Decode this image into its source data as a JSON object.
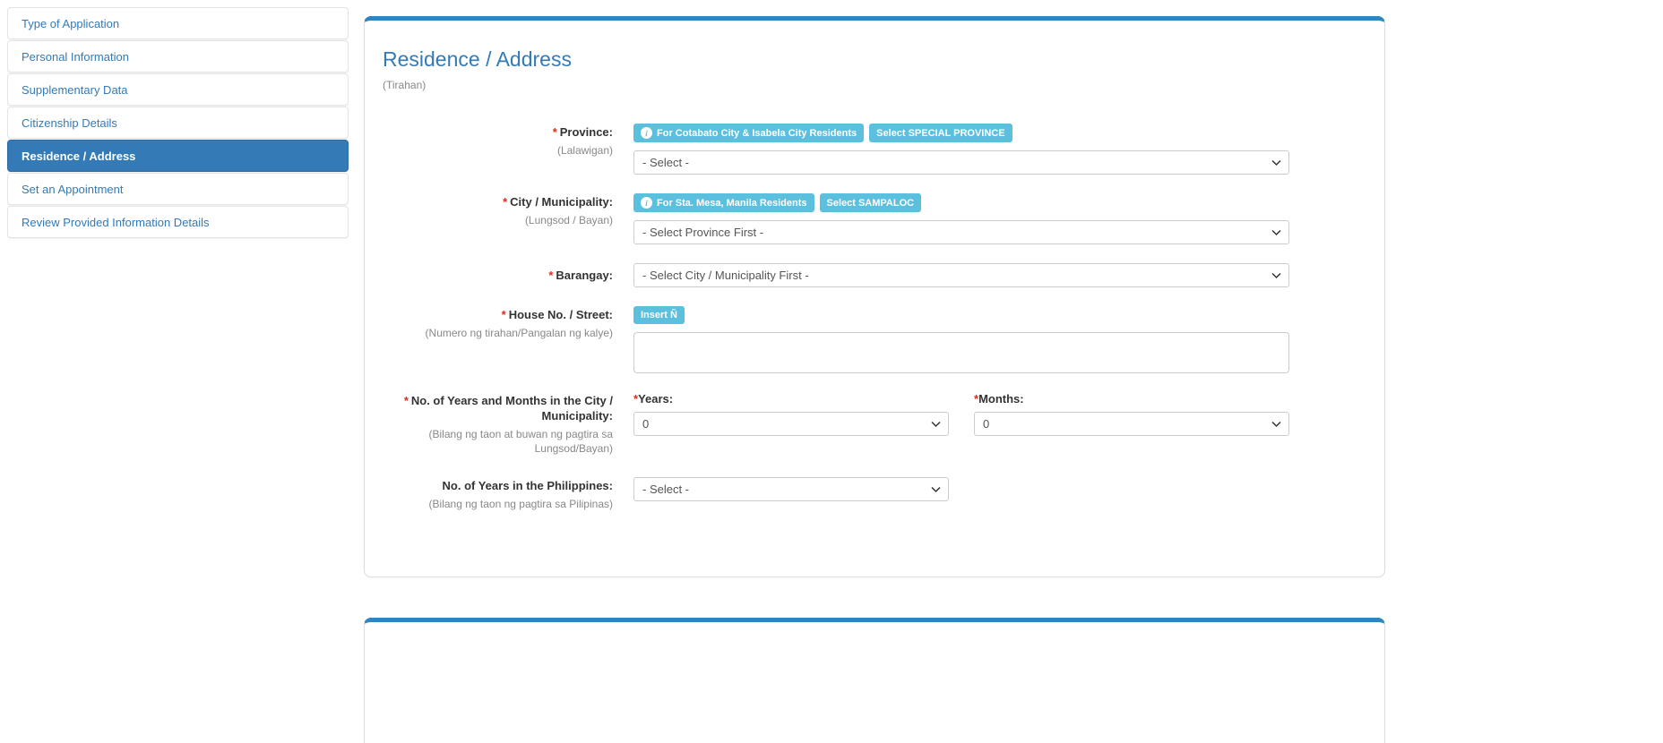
{
  "sidebar": {
    "items": [
      {
        "label": "Type of Application"
      },
      {
        "label": "Personal Information"
      },
      {
        "label": "Supplementary Data"
      },
      {
        "label": "Citizenship Details"
      },
      {
        "label": "Residence / Address"
      },
      {
        "label": "Set an Appointment"
      },
      {
        "label": "Review Provided Information Details"
      }
    ]
  },
  "panel": {
    "title": "Residence / Address",
    "subtitle": "(Tirahan)"
  },
  "icons": {
    "info": "i"
  },
  "form": {
    "required_marker": "*",
    "province": {
      "label": "Province:",
      "translation": "(Lalawigan)",
      "info_badge": "For Cotabato City & Isabela City Residents",
      "action_badge": "Select SPECIAL PROVINCE",
      "selected": "- Select -"
    },
    "city": {
      "label": "City / Municipality:",
      "translation": "(Lungsod / Bayan)",
      "info_badge": "For Sta. Mesa, Manila Residents",
      "action_badge": "Select SAMPALOC",
      "selected": "- Select Province First -"
    },
    "barangay": {
      "label": "Barangay:",
      "selected": "- Select City / Municipality First -"
    },
    "house_street": {
      "label": "House No. / Street:",
      "translation": "(Numero ng tirahan/Pangalan ng kalye)",
      "action_badge": "Insert Ñ",
      "value": ""
    },
    "years_months_city": {
      "label": "No. of Years and Months in the City / Municipality:",
      "translation": "(Bilang ng taon at buwan ng pagtira sa Lungsod/Bayan)",
      "years_label": "Years:",
      "years_selected": "0",
      "months_label": "Months:",
      "months_selected": "0"
    },
    "years_philippines": {
      "label": "No. of Years in the Philippines:",
      "translation": "(Bilang ng taon ng pagtira sa Pilipinas)",
      "selected": "- Select -"
    }
  }
}
